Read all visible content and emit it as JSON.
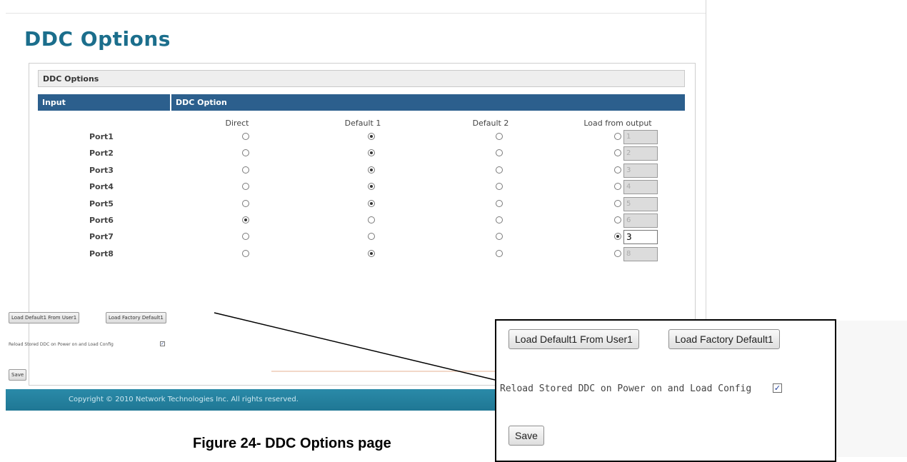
{
  "page": {
    "title": "DDC Options",
    "panel_title": "DDC Options",
    "col_input": "Input",
    "col_option": "DDC Option"
  },
  "options": [
    "Direct",
    "Default 1",
    "Default 2",
    "Load from output"
  ],
  "ports": [
    {
      "name": "Port1",
      "selected": 1,
      "output": "1"
    },
    {
      "name": "Port2",
      "selected": 1,
      "output": "2"
    },
    {
      "name": "Port3",
      "selected": 1,
      "output": "3"
    },
    {
      "name": "Port4",
      "selected": 1,
      "output": "4"
    },
    {
      "name": "Port5",
      "selected": 1,
      "output": "5"
    },
    {
      "name": "Port6",
      "selected": 0,
      "output": "6"
    },
    {
      "name": "Port7",
      "selected": 3,
      "output": "3"
    },
    {
      "name": "Port8",
      "selected": 1,
      "output": "8"
    }
  ],
  "buttons": {
    "load_default": "Load Default1 From User1",
    "load_factory": "Load Factory Default1",
    "save": "Save"
  },
  "reload_label": "Reload Stored DDC on Power on and Load Config",
  "reload_checked": true,
  "footer": "Copyright © 2010 Network Technologies Inc. All rights reserved.",
  "caption": "Figure 24- DDC Options page"
}
